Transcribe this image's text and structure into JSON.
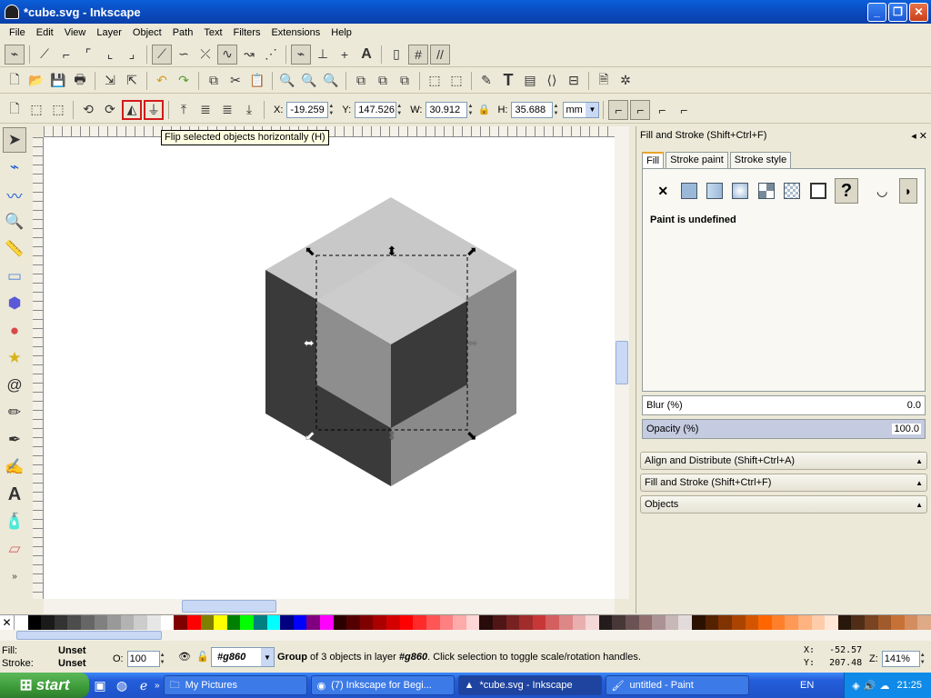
{
  "window": {
    "title": "*cube.svg - Inkscape"
  },
  "menu": [
    "File",
    "Edit",
    "View",
    "Layer",
    "Object",
    "Path",
    "Text",
    "Filters",
    "Extensions",
    "Help"
  ],
  "tool_controls": {
    "x_label": "X:",
    "x": "-19.259",
    "y_label": "Y:",
    "y": "147.526",
    "w_label": "W:",
    "w": "30.912",
    "h_label": "H:",
    "h": "35.688",
    "unit": "mm"
  },
  "tooltip": "Flip selected objects horizontally (H)",
  "dock": {
    "title": "Fill and Stroke (Shift+Ctrl+F)",
    "tabs": [
      "Fill",
      "Stroke paint",
      "Stroke style"
    ],
    "paint_status": "Paint is undefined",
    "blur_label": "Blur (%)",
    "blur": "0.0",
    "opacity_label": "Opacity (%)",
    "opacity": "100.0",
    "panels": [
      "Align and Distribute (Shift+Ctrl+A)",
      "Fill and Stroke (Shift+Ctrl+F)",
      "Objects"
    ]
  },
  "palette_colors": [
    "#ffffff",
    "#000000",
    "#1a1a1a",
    "#333333",
    "#4d4d4d",
    "#666666",
    "#808080",
    "#999999",
    "#b3b3b3",
    "#cccccc",
    "#e6e6e6",
    "#ffffff",
    "#800000",
    "#ff0000",
    "#808000",
    "#ffff00",
    "#008000",
    "#00ff00",
    "#008080",
    "#00ffff",
    "#000080",
    "#0000ff",
    "#800080",
    "#ff00ff",
    "#2b0000",
    "#550000",
    "#800000",
    "#aa0000",
    "#d40000",
    "#ff0000",
    "#ff2a2a",
    "#ff5555",
    "#ff8080",
    "#ffaaaa",
    "#ffd5d5",
    "#280b0b",
    "#501616",
    "#782121",
    "#a02c2c",
    "#c83737",
    "#d35f5f",
    "#de8787",
    "#e9afaf",
    "#f4d7d7",
    "#241c1c",
    "#483737",
    "#6c5353",
    "#916f6f",
    "#ac9393",
    "#c8b7b7",
    "#e3dbdb",
    "#2b1100",
    "#552200",
    "#803300",
    "#aa4400",
    "#d45500",
    "#ff6600",
    "#ff7f2a",
    "#ff9955",
    "#ffb380",
    "#ffccaa",
    "#ffe6d5",
    "#28170b",
    "#502d16",
    "#784421",
    "#a05a2c",
    "#c87137",
    "#d38d5f",
    "#deaa87"
  ],
  "status": {
    "fill_label": "Fill:",
    "fill": "Unset",
    "stroke_label": "Stroke:",
    "stroke": "Unset",
    "opacity_label": "O:",
    "opacity": "100",
    "layer": "#g860",
    "message_bold": "Group",
    "message_1": " of 3 objects in layer ",
    "message_layer": "#g860",
    "message_2": ". Click selection to toggle scale/rotation handles.",
    "x_label": "X:",
    "x": "-52.57",
    "y_label": "Y:",
    "y": "207.48",
    "zoom_label": "Z:",
    "zoom": "141%"
  },
  "taskbar": {
    "start": "start",
    "tasks": [
      "My Pictures",
      "(7) Inkscape for Begi...",
      "*cube.svg - Inkscape",
      "untitled - Paint"
    ],
    "lang": "EN",
    "clock": "21:25"
  }
}
